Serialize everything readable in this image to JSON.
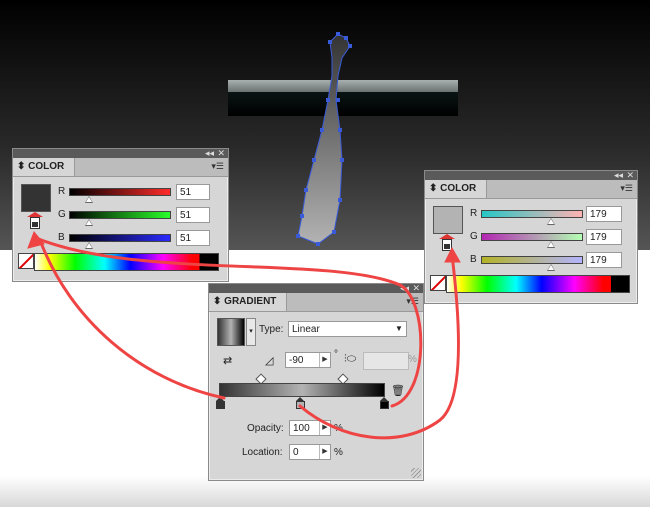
{
  "color_panel_left": {
    "title": "COLOR",
    "swatch_color": "#333333",
    "channels": [
      {
        "label": "R",
        "value": "51",
        "gradient": "linear-gradient(to right,#000,#ff2a2a)"
      },
      {
        "label": "G",
        "value": "51",
        "gradient": "linear-gradient(to right,#000,#2aff2a)"
      },
      {
        "label": "B",
        "value": "51",
        "gradient": "linear-gradient(to right,#000,#2a2aff)"
      }
    ],
    "slider_fraction": 0.2
  },
  "color_panel_right": {
    "title": "COLOR",
    "swatch_color": "#b3b3b3",
    "channels": [
      {
        "label": "R",
        "value": "179",
        "gradient": "linear-gradient(to right,#26c6c6,#ffb3b3)"
      },
      {
        "label": "G",
        "value": "179",
        "gradient": "linear-gradient(to right,#b326b3,#b3ffb3)"
      },
      {
        "label": "B",
        "value": "179",
        "gradient": "linear-gradient(to right,#b3b326,#b3b3ff)"
      }
    ],
    "slider_fraction": 0.7
  },
  "gradient_panel": {
    "title": "GRADIENT",
    "type_label": "Type:",
    "type_value": "Linear",
    "angle_value": "-90",
    "degree_symbol": "°",
    "aspect_unit": "%",
    "opacity_label": "Opacity:",
    "opacity_value": "100",
    "opacity_unit": "%",
    "location_label": "Location:",
    "location_value": "0",
    "location_unit": "%"
  },
  "icons": [
    "collapse-icon",
    "close-icon",
    "panel-menu-icon",
    "trash-icon",
    "reverse-gradient-icon",
    "angle-icon",
    "aspect-ratio-icon",
    "fill-stroke-icon",
    "none-swatch-icon",
    "chevron-down-icon"
  ],
  "accent_colors": {
    "arrow": "#ee4444",
    "path": "#3a5bd9"
  }
}
